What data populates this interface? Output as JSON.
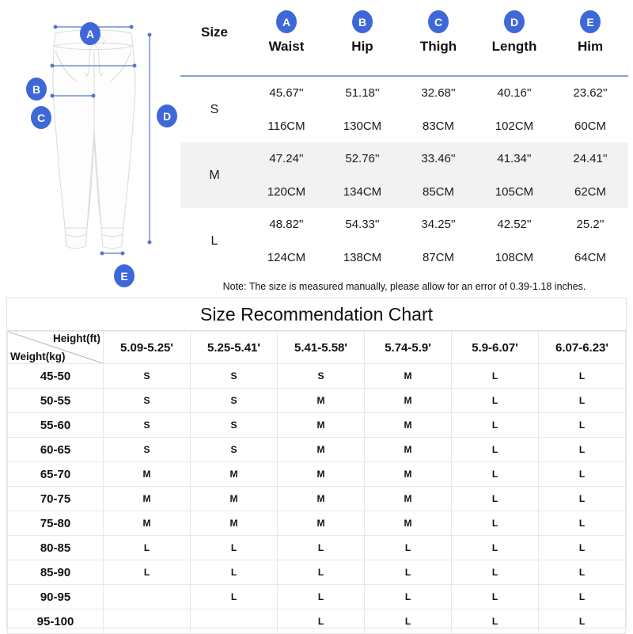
{
  "diagram": {
    "markers": [
      {
        "id": "A",
        "label": "A",
        "measure": "Waist"
      },
      {
        "id": "B",
        "label": "B",
        "measure": "Hip"
      },
      {
        "id": "C",
        "label": "C",
        "measure": "Thigh"
      },
      {
        "id": "D",
        "label": "D",
        "measure": "Length"
      },
      {
        "id": "E",
        "label": "E",
        "measure": "Him"
      }
    ]
  },
  "size_table": {
    "size_header": "Size",
    "columns": [
      {
        "badge": "A",
        "label": "Waist"
      },
      {
        "badge": "B",
        "label": "Hip"
      },
      {
        "badge": "C",
        "label": "Thigh"
      },
      {
        "badge": "D",
        "label": "Length"
      },
      {
        "badge": "E",
        "label": "Him"
      }
    ],
    "rows": [
      {
        "size": "S",
        "highlight": false,
        "inches": [
          "45.67''",
          "51.18''",
          "32.68''",
          "40.16''",
          "23.62''"
        ],
        "cm": [
          "116CM",
          "130CM",
          "83CM",
          "102CM",
          "60CM"
        ]
      },
      {
        "size": "M",
        "highlight": true,
        "inches": [
          "47.24''",
          "52.76''",
          "33.46''",
          "41.34''",
          "24.41''"
        ],
        "cm": [
          "120CM",
          "134CM",
          "85CM",
          "105CM",
          "62CM"
        ]
      },
      {
        "size": "L",
        "highlight": false,
        "inches": [
          "48.82''",
          "54.33''",
          "34.25''",
          "42.52''",
          "25.2''"
        ],
        "cm": [
          "124CM",
          "138CM",
          "87CM",
          "108CM",
          "64CM"
        ]
      }
    ],
    "note": "Note: The size is measured manually, please allow for an error of 0.39-1.18 inches."
  },
  "recommendation_chart": {
    "title": "Size Recommendation  Chart",
    "height_label": "Height(ft)",
    "weight_label": "Weight(kg)",
    "height_columns": [
      "5.09-5.25'",
      "5.25-5.41'",
      "5.41-5.58'",
      "5.74-5.9'",
      "5.9-6.07'",
      "6.07-6.23'"
    ],
    "rows": [
      {
        "weight": "45-50",
        "sizes": [
          "S",
          "S",
          "S",
          "M",
          "L",
          "L"
        ]
      },
      {
        "weight": "50-55",
        "sizes": [
          "S",
          "S",
          "M",
          "M",
          "L",
          "L"
        ]
      },
      {
        "weight": "55-60",
        "sizes": [
          "S",
          "S",
          "M",
          "M",
          "L",
          "L"
        ]
      },
      {
        "weight": "60-65",
        "sizes": [
          "S",
          "S",
          "M",
          "M",
          "L",
          "L"
        ]
      },
      {
        "weight": "65-70",
        "sizes": [
          "M",
          "M",
          "M",
          "M",
          "L",
          "L"
        ]
      },
      {
        "weight": "70-75",
        "sizes": [
          "M",
          "M",
          "M",
          "M",
          "L",
          "L"
        ]
      },
      {
        "weight": "75-80",
        "sizes": [
          "M",
          "M",
          "M",
          "M",
          "L",
          "L"
        ]
      },
      {
        "weight": "80-85",
        "sizes": [
          "L",
          "L",
          "L",
          "L",
          "L",
          "L"
        ]
      },
      {
        "weight": "85-90",
        "sizes": [
          "L",
          "L",
          "L",
          "L",
          "L",
          "L"
        ]
      },
      {
        "weight": "90-95",
        "sizes": [
          "",
          "L",
          "L",
          "L",
          "L",
          "L"
        ]
      },
      {
        "weight": "95-100",
        "sizes": [
          "",
          "",
          "L",
          "L",
          "L",
          "L"
        ]
      }
    ]
  },
  "colors": {
    "badge_blue": "#3e68d9",
    "rule_blue": "#8ba3d4",
    "row_highlight": "#f2f2f2",
    "diagram_line": "#d8d8d8",
    "dimension_line": "#5a75c9"
  }
}
